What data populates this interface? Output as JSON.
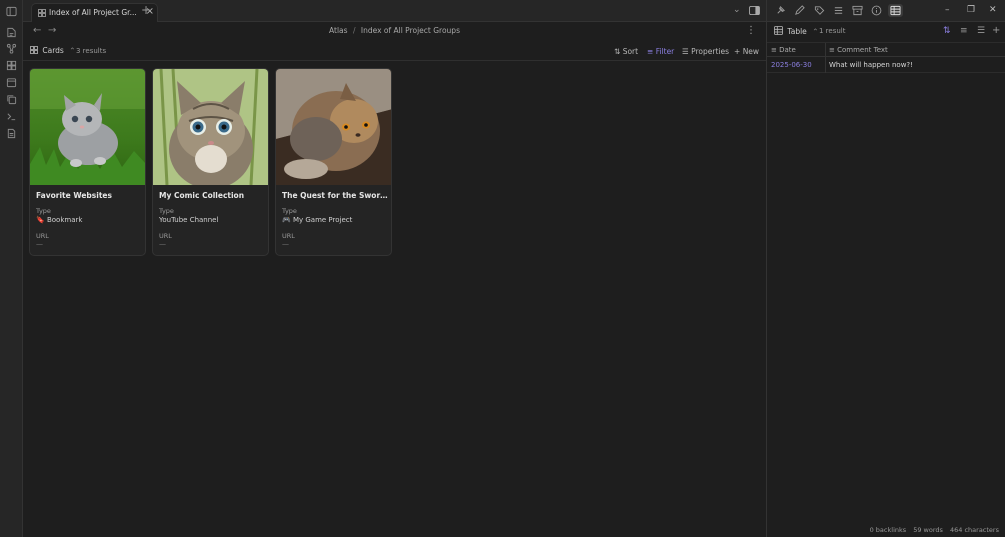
{
  "ribbon": {
    "icons": [
      "files-icon",
      "graph-icon",
      "bases-icon",
      "calendar-icon",
      "copy-icon",
      "terminal-icon",
      "note-icon"
    ]
  },
  "tabbar": {
    "tab_title": "Index of All Project Gr...",
    "tab_close": "×",
    "new_tab": "+",
    "chevron": "⌄"
  },
  "window": {
    "minimize": "–",
    "restore": "❐",
    "close": "✕"
  },
  "nav": {
    "back": "←",
    "forward": "→",
    "breadcrumb_parent": "Atlas",
    "breadcrumb_sep": "/",
    "breadcrumb_current": "Index of All Project Groups",
    "more": "⋮"
  },
  "viewbar": {
    "view_label": "Cards",
    "view_chevron": "⌃",
    "results": "3 results",
    "sort": "Sort",
    "filter": "Filter",
    "properties": "Properties",
    "new": "New",
    "accent_color": "#8b7fe0"
  },
  "cards": [
    {
      "title": "Favorite Websites",
      "type_label": "Type",
      "type_icon": "🔖",
      "type_value": "Bookmark",
      "url_label": "URL",
      "url_value": "—",
      "image": "kitten-on-grass-image"
    },
    {
      "title": "My Comic Collection",
      "type_label": "Type",
      "type_icon": "",
      "type_value": "YouTube Channel",
      "url_label": "URL",
      "url_value": "—",
      "image": "tabby-kitten-image"
    },
    {
      "title": "The Quest for the Sword ...",
      "type_label": "Type",
      "type_icon": "🎮",
      "type_value": "My Game Project",
      "url_label": "URL",
      "url_value": "—",
      "image": "persian-cat-image"
    }
  ],
  "right_panel": {
    "view_label": "Table",
    "view_chevron": "⌃",
    "results": "1 result",
    "columns": [
      {
        "label": "Date",
        "icon": "≡"
      },
      {
        "label": "Comment Text",
        "icon": "≡"
      }
    ],
    "rows": [
      {
        "date": "2025-06-30",
        "text": "What will happen now?!"
      }
    ]
  },
  "status": {
    "backlinks": "0 backlinks",
    "words": "59 words",
    "characters": "464 characters"
  }
}
